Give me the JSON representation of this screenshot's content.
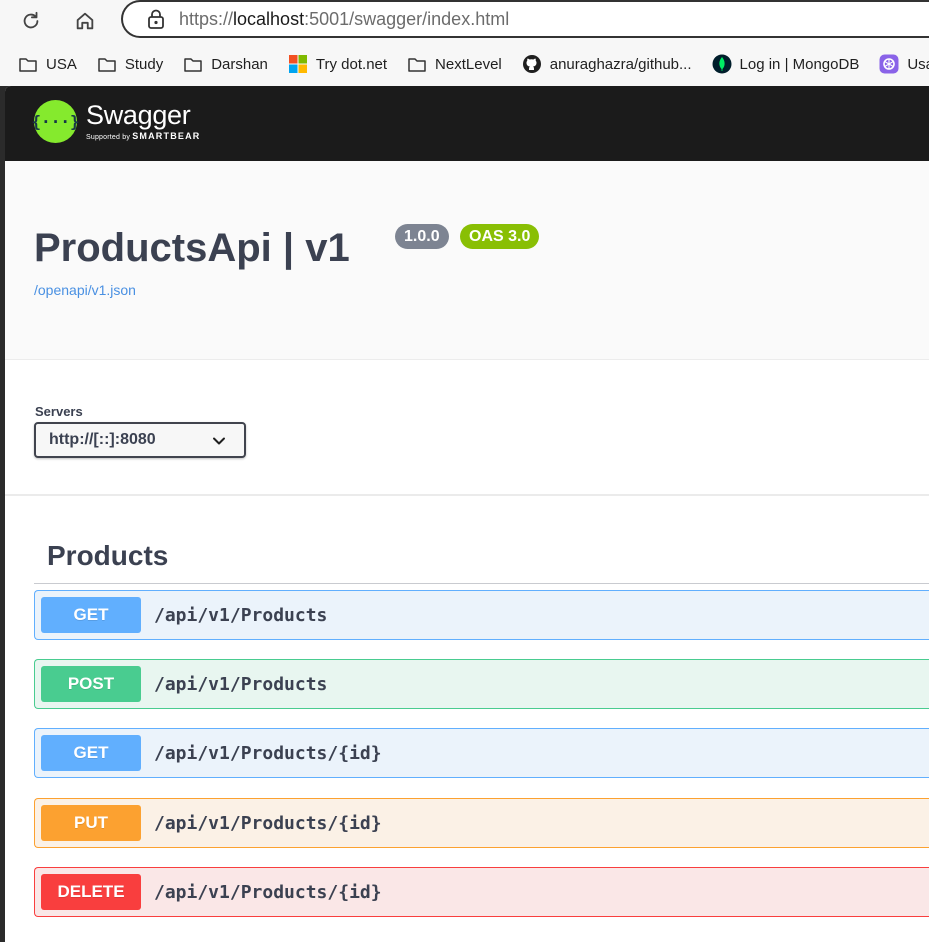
{
  "browser": {
    "url_prefix": "https://",
    "url_host": "localhost",
    "url_rest": ":5001/swagger/index.html",
    "bookmarks": [
      {
        "label": "USA",
        "icon": "folder-icon"
      },
      {
        "label": "Study",
        "icon": "folder-icon"
      },
      {
        "label": "Darshan",
        "icon": "folder-icon"
      },
      {
        "label": "Try dot.net",
        "icon": "microsoft-icon"
      },
      {
        "label": "NextLevel",
        "icon": "folder-icon"
      },
      {
        "label": "anuraghazra/github...",
        "icon": "github-icon"
      },
      {
        "label": "Log in | MongoDB",
        "icon": "mongodb-icon"
      },
      {
        "label": "Usag",
        "icon": "chatgpt-icon"
      }
    ]
  },
  "swagger": {
    "logo_glyph": "{···}",
    "logo_word": "Swagger",
    "logo_supported": "Supported by",
    "logo_brand": "SMARTBEAR"
  },
  "info": {
    "title": "ProductsApi | v1",
    "version": "1.0.0",
    "oas": "OAS 3.0",
    "spec_link": "/openapi/v1.json"
  },
  "servers": {
    "label": "Servers",
    "selected": "http://[::]:8080"
  },
  "tag": {
    "name": "Products"
  },
  "operations": [
    {
      "method": "GET",
      "path": "/api/v1/Products"
    },
    {
      "method": "POST",
      "path": "/api/v1/Products"
    },
    {
      "method": "GET",
      "path": "/api/v1/Products/{id}"
    },
    {
      "method": "PUT",
      "path": "/api/v1/Products/{id}"
    },
    {
      "method": "DELETE",
      "path": "/api/v1/Products/{id}"
    }
  ],
  "colors": {
    "get": "#61affe",
    "post": "#49cc90",
    "put": "#fca130",
    "delete": "#f93e3e",
    "swagger_green": "#85ea2d",
    "topbar": "#1b1b1b"
  }
}
